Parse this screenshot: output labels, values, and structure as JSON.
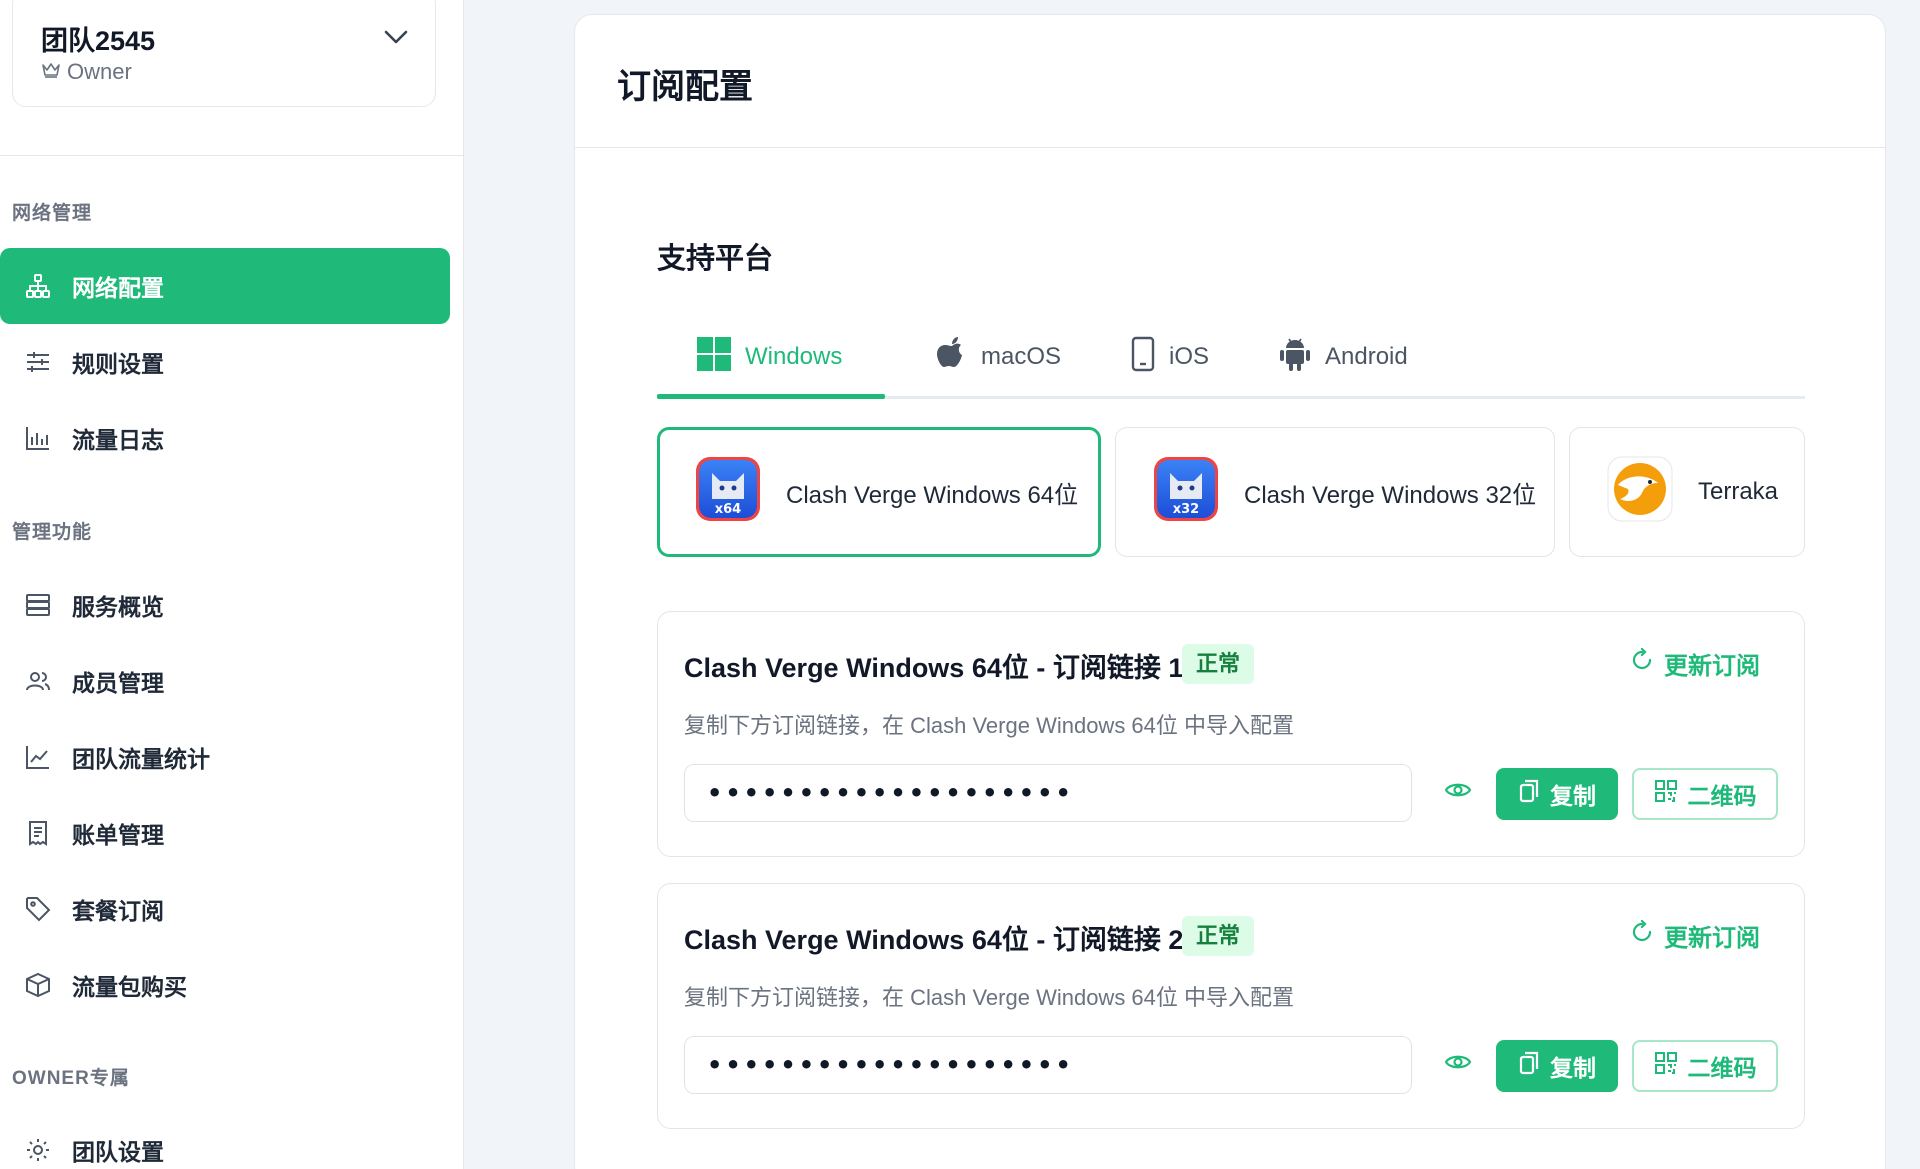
{
  "team": {
    "name": "团队2545",
    "role": "Owner"
  },
  "sidebar": {
    "sections": [
      {
        "label": "网络管理",
        "items": [
          {
            "label": "网络配置",
            "icon": "network-icon",
            "active": true
          },
          {
            "label": "规则设置",
            "icon": "sliders-icon"
          },
          {
            "label": "流量日志",
            "icon": "bar-chart-icon"
          }
        ]
      },
      {
        "label": "管理功能",
        "items": [
          {
            "label": "服务概览",
            "icon": "server-icon"
          },
          {
            "label": "成员管理",
            "icon": "users-icon"
          },
          {
            "label": "团队流量统计",
            "icon": "line-chart-icon"
          },
          {
            "label": "账单管理",
            "icon": "receipt-icon"
          },
          {
            "label": "套餐订阅",
            "icon": "tag-icon"
          },
          {
            "label": "流量包购买",
            "icon": "package-icon"
          }
        ]
      },
      {
        "label": "OWNER专属",
        "items": [
          {
            "label": "团队设置",
            "icon": "gear-icon"
          }
        ]
      }
    ]
  },
  "main": {
    "title": "订阅配置",
    "platforms_title": "支持平台",
    "tabs": [
      {
        "label": "Windows",
        "icon": "windows-icon",
        "active": true
      },
      {
        "label": "macOS",
        "icon": "apple-icon"
      },
      {
        "label": "iOS",
        "icon": "phone-icon"
      },
      {
        "label": "Android",
        "icon": "android-icon"
      }
    ],
    "clients": [
      {
        "label": "Clash Verge Windows 64位",
        "badge": "x64",
        "selected": true
      },
      {
        "label": "Clash Verge Windows 32位",
        "badge": "x32"
      },
      {
        "label": "Terraka"
      }
    ],
    "subscriptions": [
      {
        "title": "Clash Verge Windows 64位 - 订阅链接 1",
        "status": "正常",
        "refresh_label": "更新订阅",
        "description": "复制下方订阅链接，在 Clash Verge Windows 64位 中导入配置",
        "token_masked": "••••••••••••••••••••",
        "copy_label": "复制",
        "qr_label": "二维码"
      },
      {
        "title": "Clash Verge Windows 64位 - 订阅链接 2",
        "status": "正常",
        "refresh_label": "更新订阅",
        "description": "复制下方订阅链接，在 Clash Verge Windows 64位 中导入配置",
        "token_masked": "••••••••••••••••••••",
        "copy_label": "复制",
        "qr_label": "二维码"
      }
    ]
  },
  "colors": {
    "accent": "#1fba7a",
    "badge_bg": "#dcfce7",
    "badge_text": "#15803d"
  }
}
